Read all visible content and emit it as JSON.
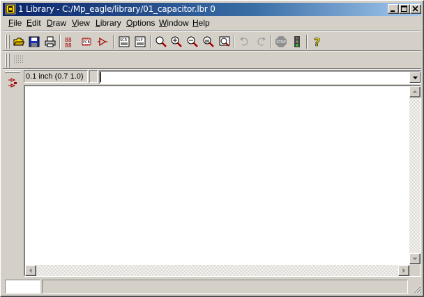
{
  "window": {
    "title": "1 Library - C:/Mp_eagle/library/01_capacitor.lbr 0",
    "controls": [
      "minimize",
      "maximize",
      "close"
    ]
  },
  "menu": {
    "items": [
      {
        "label": "File",
        "mnemonic": "F",
        "rest": "ile"
      },
      {
        "label": "Edit",
        "mnemonic": "E",
        "rest": "dit"
      },
      {
        "label": "Draw",
        "mnemonic": "D",
        "rest": "raw"
      },
      {
        "label": "View",
        "mnemonic": "V",
        "rest": "iew"
      },
      {
        "label": "Library",
        "mnemonic": "L",
        "rest": "ibrary"
      },
      {
        "label": "Options",
        "mnemonic": "O",
        "rest": "ptions"
      },
      {
        "label": "Window",
        "mnemonic": "W",
        "rest": "indow"
      },
      {
        "label": "Help",
        "mnemonic": "H",
        "rest": "elp"
      }
    ]
  },
  "toolbar": {
    "buttons": [
      "open-icon",
      "save-icon",
      "print-icon",
      "device-icon",
      "package-icon",
      "symbol-icon",
      "script-icon",
      "ulp-icon",
      "zoom-fit-icon",
      "zoom-in-icon",
      "zoom-out-icon",
      "zoom-redraw-icon",
      "zoom-select-icon",
      "undo-icon",
      "redo-icon",
      "stop-icon",
      "go-icon",
      "help-icon"
    ]
  },
  "command": {
    "grid_readout": "0.1 inch (0.7 1.0)",
    "input_value": ""
  },
  "colors": {
    "title_start": "#0a246a",
    "title_end": "#a6caf0",
    "face": "#d4d0c8",
    "canvas": "#ffffff"
  }
}
